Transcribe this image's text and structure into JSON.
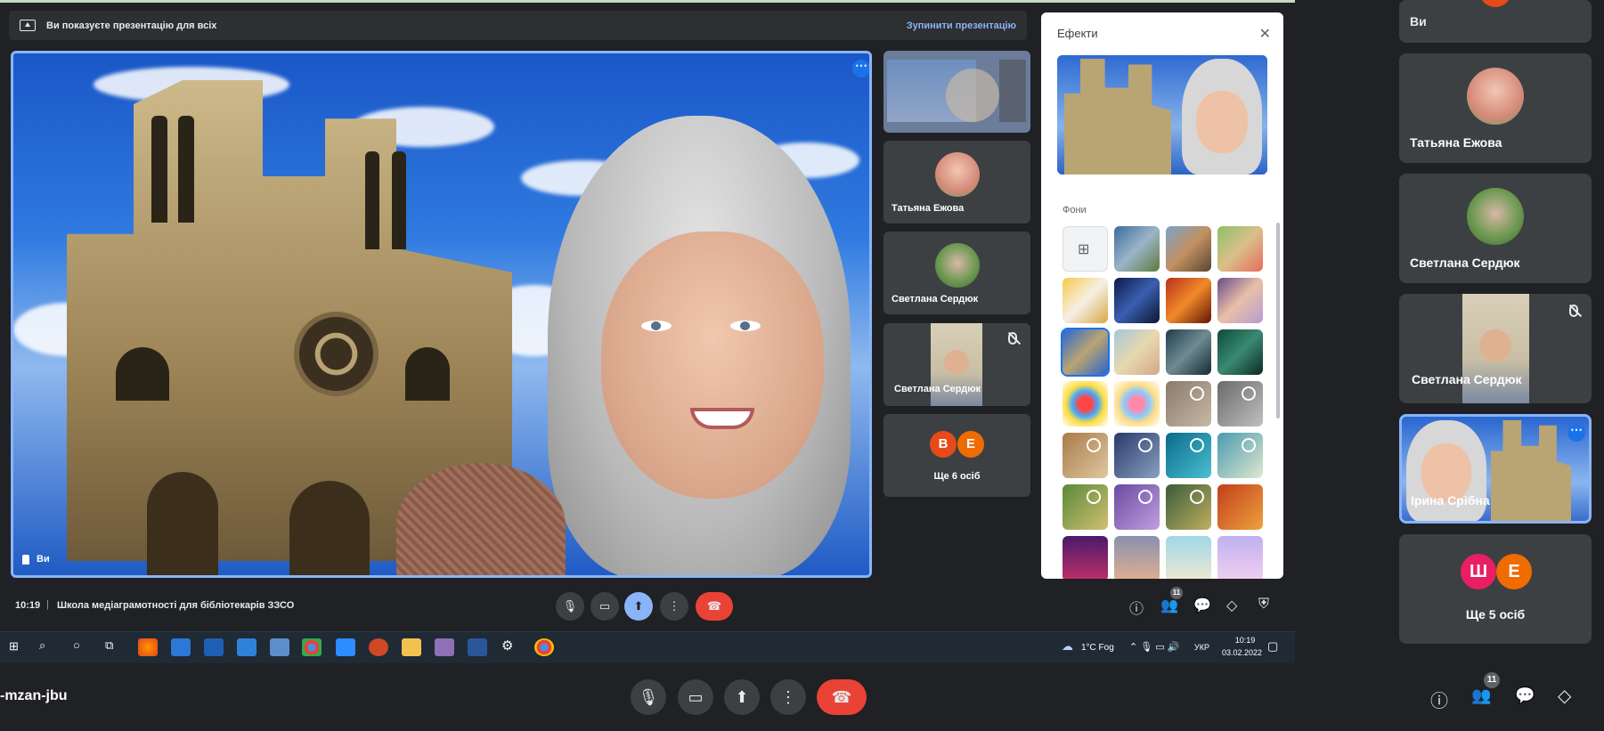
{
  "presentation_bar": {
    "message": "Ви показуєте презентацію для всіх",
    "stop_label": "Зупинити презентацію"
  },
  "main_tile": {
    "name": "Ви",
    "more_icon": "⋯"
  },
  "side_tiles": [
    {
      "name": "Татьяна Ежова"
    },
    {
      "name": "Светлана Сердюк"
    },
    {
      "name": "Светлана Сердюк"
    },
    {
      "avatars": [
        "В",
        "Е"
      ],
      "label": "Ще 6 осіб"
    }
  ],
  "effects": {
    "title": "Ефекти",
    "close_icon": "✕",
    "backgrounds_label": "Фони"
  },
  "inner_bar": {
    "time": "10:19",
    "separator": "|",
    "meeting_title": "Школа медіаграмотності для бібліотекарів ЗЗСО",
    "participants_count": "11"
  },
  "taskbar": {
    "weather": "1°C  Fog",
    "lang": "УКР",
    "time": "10:19",
    "date": "03.02.2022"
  },
  "outer_tiles": [
    {
      "name": "Ви"
    },
    {
      "name": "Татьяна Ежова"
    },
    {
      "name": "Светлана Сердюк"
    },
    {
      "name": "Светлана Сердюк"
    },
    {
      "name": "Ірина Срібна"
    },
    {
      "avatars": [
        "Ш",
        "Е"
      ],
      "label": "Ще 5 осіб"
    }
  ],
  "outer_bar": {
    "meeting_code": "-mzan-jbu",
    "participants_count": "11"
  },
  "colors": {
    "accent": "#8ab4f8",
    "end_call": "#ea4335",
    "tile_bg": "#3c4043",
    "page_bg": "#202124"
  }
}
